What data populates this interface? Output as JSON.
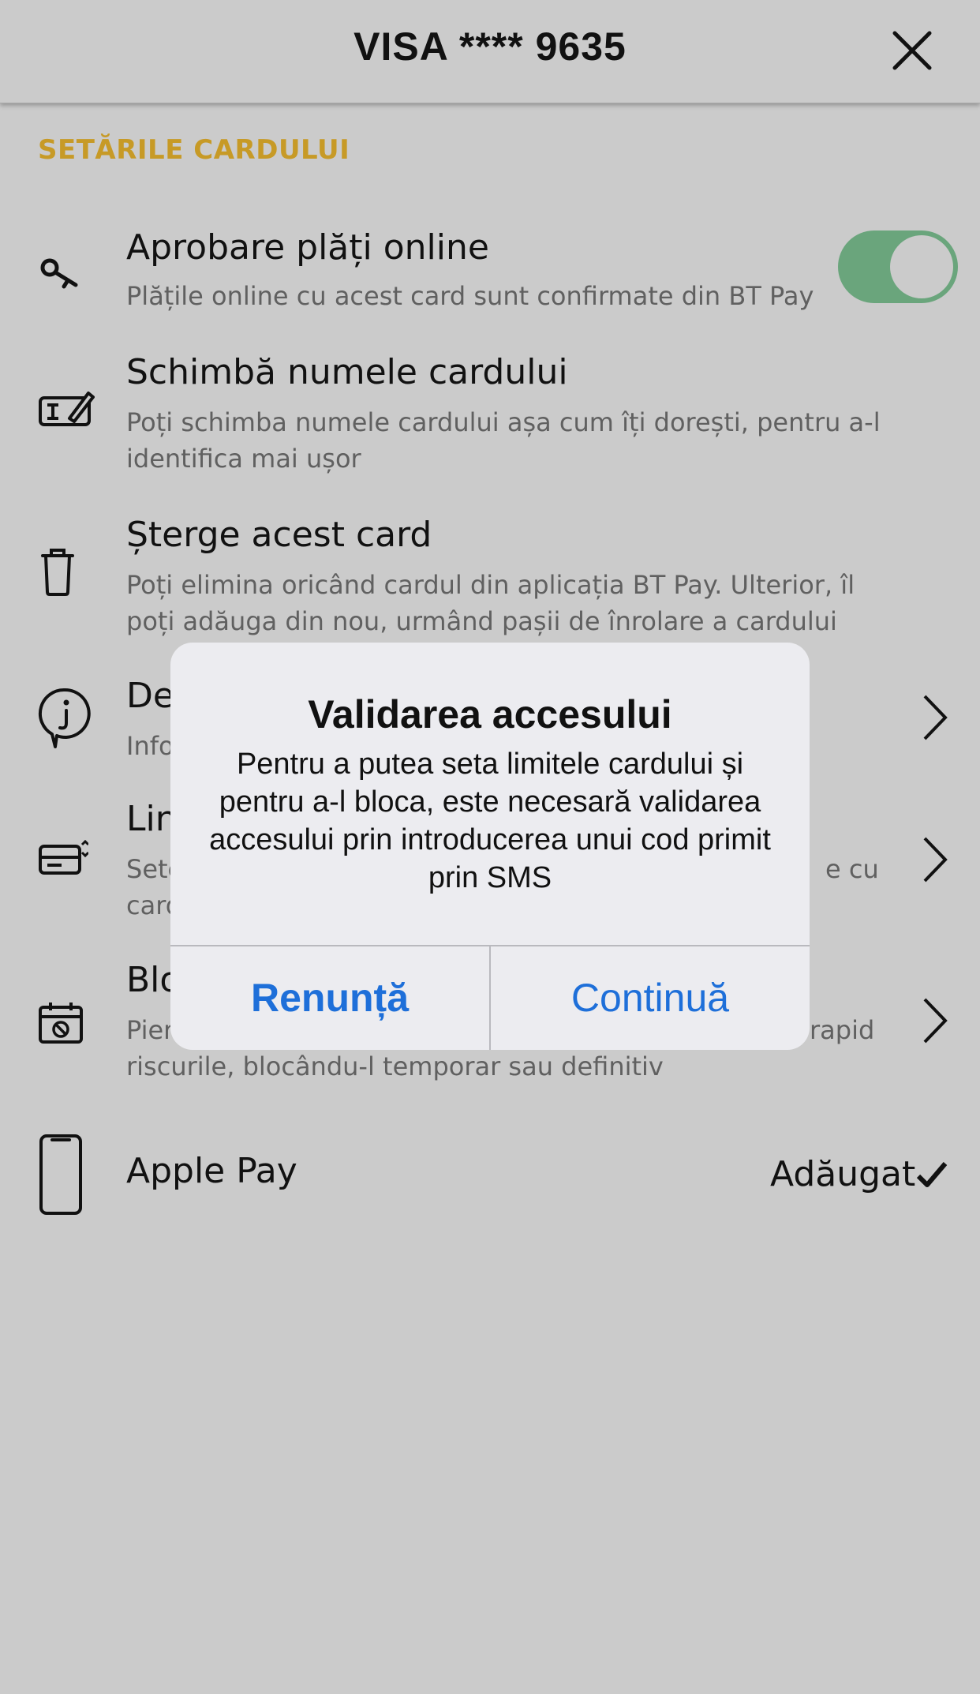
{
  "header": {
    "title": "VISA **** 9635"
  },
  "section": {
    "title": "SETĂRILE CARDULUI"
  },
  "rows": {
    "online": {
      "title": "Aprobare plăți online",
      "desc": "Plățile online cu acest card sunt confirmate din BT Pay",
      "toggle_on": true
    },
    "rename": {
      "title": "Schimbă numele cardului",
      "desc": "Poți schimba numele cardului așa cum îți dorești, pentru a-l identifica mai ușor"
    },
    "delete": {
      "title": "Șterge acest card",
      "desc": "Poți elimina oricând cardul din aplicația BT Pay. Ulterior, îl poți adăuga din nou, urmând pașii de înrolare a cardului"
    },
    "details": {
      "title": "De",
      "desc": "Info"
    },
    "limits": {
      "title": "Lin",
      "desc_line1_left": "Sete",
      "desc_line1_right": "e cu",
      "desc_line2": "card"
    },
    "block": {
      "title": "Blo",
      "desc_line1_left": "Pier",
      "desc_line1_right": "rapid",
      "desc_line2": "riscurile, blocându-l temporar sau definitiv"
    },
    "applepay": {
      "title": "Apple Pay",
      "status": "Adăugat"
    }
  },
  "dialog": {
    "title": "Validarea accesului",
    "message": "Pentru a putea seta limitele cardului și pentru a-l bloca, este necesară validarea accesului prin introducerea unui cod primit prin SMS",
    "cancel_label": "Renunță",
    "continue_label": "Continuă"
  },
  "colors": {
    "background": "#cbcbcb",
    "section_title": "#c79a26",
    "toggle_on": "#6aa57c",
    "dialog_button": "#1e6fd9"
  }
}
